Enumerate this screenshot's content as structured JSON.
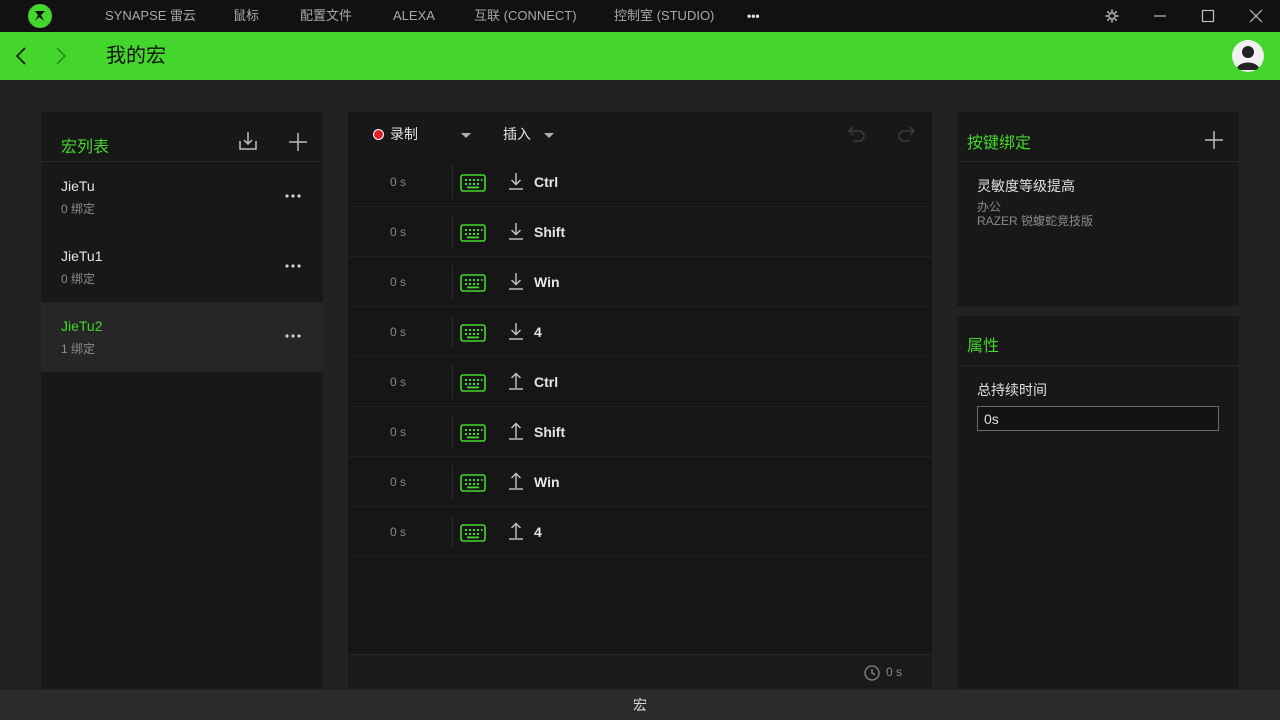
{
  "topbar": {
    "nav": [
      "SYNAPSE 雷云",
      "鼠标",
      "配置文件",
      "ALEXA",
      "互联 (CONNECT)",
      "控制室 (STUDIO)"
    ],
    "more": "•••"
  },
  "header": {
    "title": "我的宏"
  },
  "macro_list": {
    "title": "宏列表",
    "items": [
      {
        "name": "JieTu",
        "binds": "0 绑定",
        "selected": false
      },
      {
        "name": "JieTu1",
        "binds": "0 绑定",
        "selected": false
      },
      {
        "name": "JieTu2",
        "binds": "1 绑定",
        "selected": true
      }
    ]
  },
  "editor": {
    "record_label": "录制",
    "insert_label": "插入",
    "rows": [
      {
        "time": "0 s",
        "direction": "down",
        "key": "Ctrl"
      },
      {
        "time": "0 s",
        "direction": "down",
        "key": "Shift"
      },
      {
        "time": "0 s",
        "direction": "down",
        "key": "Win"
      },
      {
        "time": "0 s",
        "direction": "down",
        "key": "4"
      },
      {
        "time": "0 s",
        "direction": "up",
        "key": "Ctrl"
      },
      {
        "time": "0 s",
        "direction": "up",
        "key": "Shift"
      },
      {
        "time": "0 s",
        "direction": "up",
        "key": "Win"
      },
      {
        "time": "0 s",
        "direction": "up",
        "key": "4"
      }
    ],
    "total_time": "0 s"
  },
  "key_binding": {
    "title": "按键绑定",
    "name": "灵敏度等级提高",
    "profile": "办公",
    "device": "RAZER 锐蝮蛇竞技版"
  },
  "properties": {
    "title": "属性",
    "duration_label": "总持续时间",
    "duration_value": "0s"
  },
  "bottombar": {
    "label": "宏"
  },
  "colors": {
    "accent": "#44d62c",
    "record": "#e0202a"
  }
}
